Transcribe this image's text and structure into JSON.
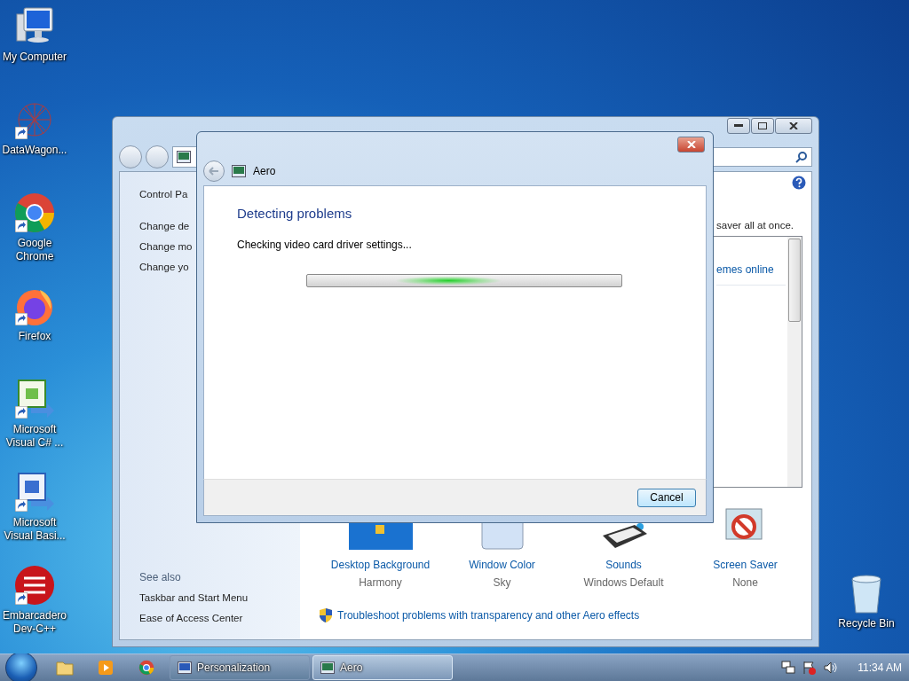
{
  "desktop_icons": [
    {
      "kind": "computer",
      "label": "My Computer",
      "shortcut": false
    },
    {
      "kind": "network",
      "label": "DataWagon...",
      "shortcut": true
    },
    {
      "kind": "chrome",
      "label": "Google Chrome",
      "shortcut": true
    },
    {
      "kind": "firefox",
      "label": "Firefox",
      "shortcut": true
    },
    {
      "kind": "csharp",
      "label": "Microsoft Visual C# ...",
      "shortcut": true
    },
    {
      "kind": "vb",
      "label": "Microsoft Visual Basi...",
      "shortcut": true
    },
    {
      "kind": "devcpp",
      "label": "Embarcadero Dev-C++",
      "shortcut": true
    }
  ],
  "recycle_bin": {
    "label": "Recycle Bin"
  },
  "personalization_window": {
    "sidebar": {
      "home": "Control Pa",
      "links": [
        "Change de",
        "Change mo",
        "Change yo"
      ],
      "see_also_title": "See also",
      "see_also": [
        "Taskbar and Start Menu",
        "Ease of Access Center"
      ]
    },
    "intro_text": "saver all at once.",
    "theme_link": "emes online",
    "settings": [
      {
        "kind": "background",
        "label": "Desktop Background",
        "value": "Harmony"
      },
      {
        "kind": "color",
        "label": "Window Color",
        "value": "Sky"
      },
      {
        "kind": "sounds",
        "label": "Sounds",
        "value": "Windows Default"
      },
      {
        "kind": "screensaver",
        "label": "Screen Saver",
        "value": "None"
      }
    ],
    "troubleshoot_link": "Troubleshoot problems with transparency and other Aero effects"
  },
  "dialog": {
    "title": "Aero",
    "heading": "Detecting problems",
    "status": "Checking video card driver settings...",
    "progress": {
      "indeterminate": true
    },
    "buttons": [
      "Cancel"
    ]
  },
  "taskbar": {
    "pinned": [
      {
        "kind": "explorer"
      },
      {
        "kind": "media"
      },
      {
        "kind": "chrome"
      }
    ],
    "tasks": [
      {
        "kind": "personalization",
        "label": "Personalization",
        "selected": false
      },
      {
        "kind": "aero",
        "label": "Aero",
        "selected": true
      }
    ],
    "clock": "11:34 AM"
  }
}
